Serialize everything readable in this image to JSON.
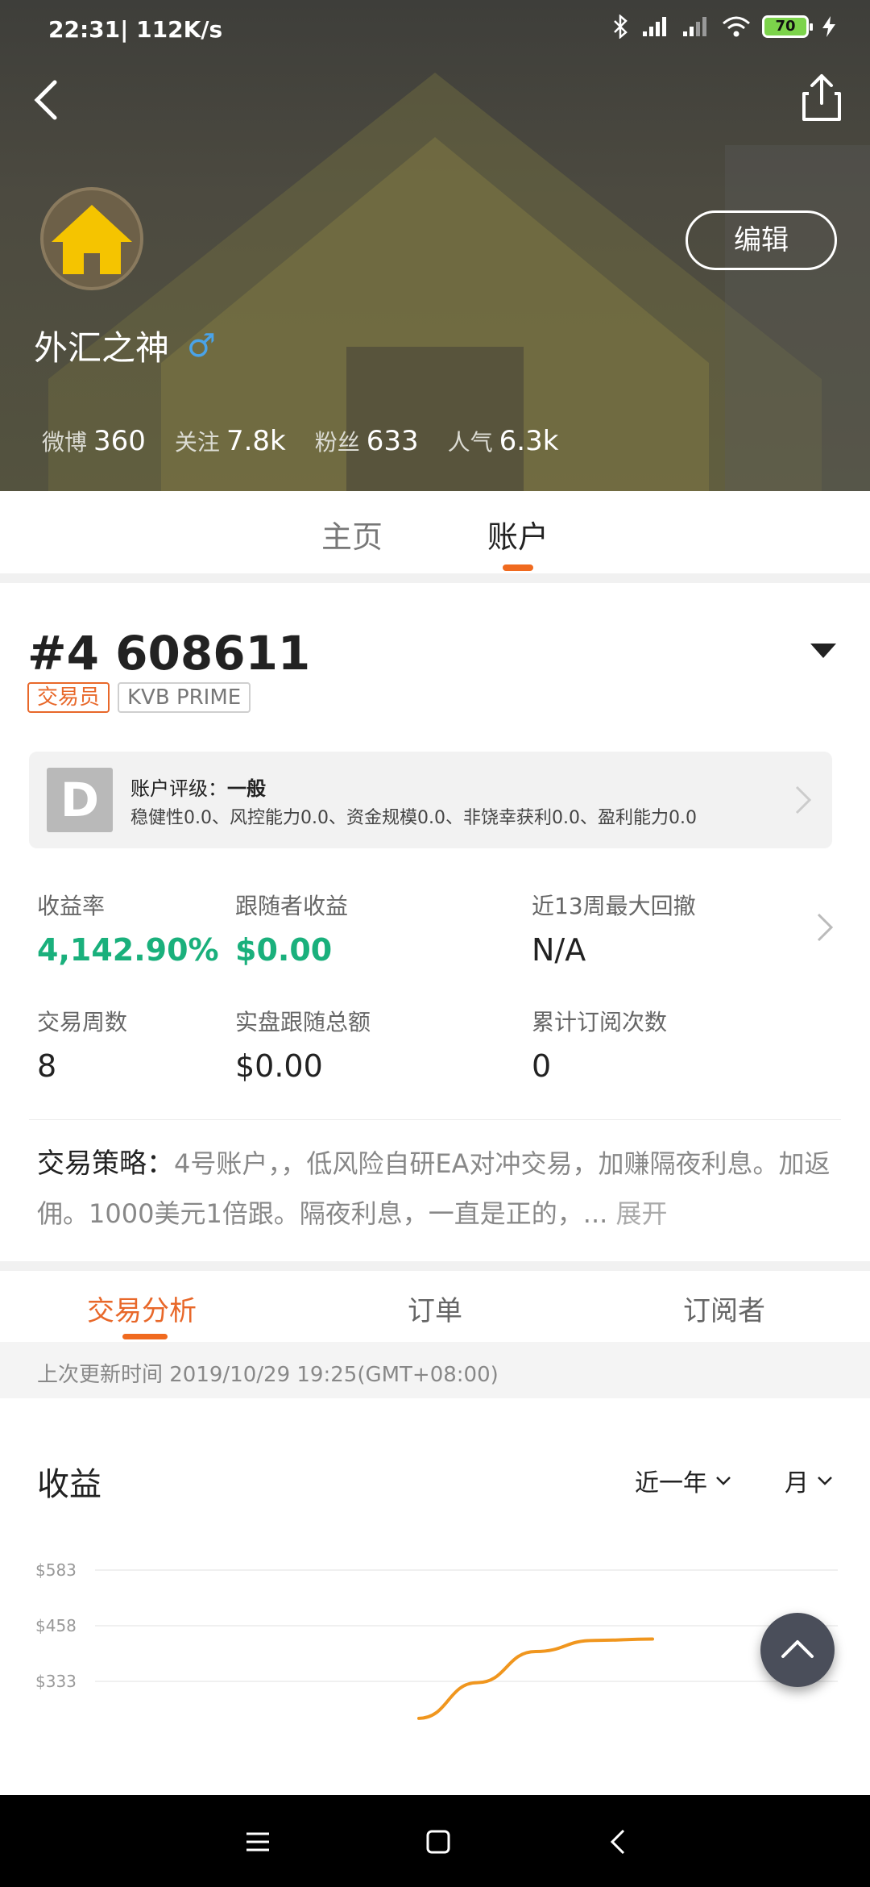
{
  "status_bar": {
    "time": "22:31",
    "speed": "| 112K/s",
    "battery": "70"
  },
  "header": {
    "edit_label": "编辑",
    "username": "外汇之神",
    "gender_symbol": "♂",
    "stats": [
      {
        "label": "微博",
        "value": "360"
      },
      {
        "label": "关注",
        "value": "7.8k"
      },
      {
        "label": "粉丝",
        "value": "633"
      },
      {
        "label": "人气",
        "value": "6.3k"
      }
    ]
  },
  "main_tabs": {
    "home": "主页",
    "account": "账户"
  },
  "account": {
    "number": "#4 608611",
    "tag_trader": "交易员",
    "tag_broker": "KVB PRIME",
    "rating": {
      "letter": "D",
      "title_label": "账户评级：",
      "title_value": "一般",
      "desc": "稳健性0.0、风控能力0.0、资金规模0.0、非饶幸获利0.0、盈利能力0.0"
    },
    "metrics": [
      {
        "label": "收益率",
        "value": "4,142.90%"
      },
      {
        "label": "跟随者收益",
        "value": "$0.00"
      },
      {
        "label": "近13周最大回撤",
        "value": "N/A"
      },
      {
        "label": "交易周数",
        "value": "8"
      },
      {
        "label": "实盘跟随总额",
        "value": "$0.00"
      },
      {
        "label": "累计订阅次数",
        "value": "0"
      }
    ],
    "strategy": {
      "lead": "交易策略：",
      "text": "4号账户，，低风险自研EA对冲交易，加赚隔夜利息。加返佣。1000美元1倍跟。隔夜利息，一直是正的，...",
      "more": " 展开"
    }
  },
  "sub_tabs": {
    "analysis": "交易分析",
    "orders": "订单",
    "subscribers": "订阅者"
  },
  "update_time": "上次更新时间 2019/10/29 19:25(GMT+08:00)",
  "chart_section": {
    "title": "收益",
    "range_filter": "近一年",
    "period_filter": "月"
  },
  "chart_data": {
    "type": "line",
    "title": "收益",
    "y_ticks": [
      "$583",
      "$458",
      "$333"
    ],
    "series": [
      {
        "color": "#f0961e",
        "points": [
          [
            0.0,
            250
          ],
          [
            0.25,
            330
          ],
          [
            0.5,
            400
          ],
          [
            0.75,
            425
          ],
          [
            1.0,
            428
          ]
        ]
      }
    ],
    "grid": true
  },
  "colors": {
    "accent": "#f06a1f",
    "positive": "#1ab07c",
    "chart_line": "#f0961e"
  }
}
